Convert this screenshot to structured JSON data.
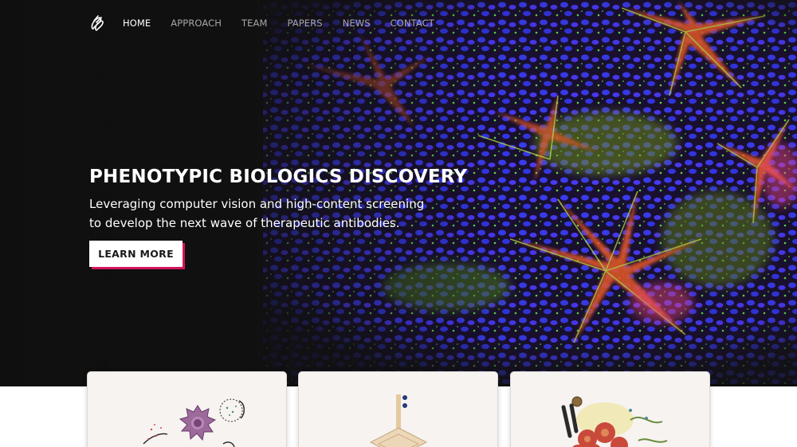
{
  "nav": {
    "logo_icon": "rootpath-logo-icon",
    "items": [
      {
        "label": "HOME",
        "active": true
      },
      {
        "label": "APPROACH",
        "active": false
      },
      {
        "label": "TEAM",
        "active": false
      },
      {
        "label": "PAPERS",
        "active": false
      },
      {
        "label": "NEWS",
        "active": false
      },
      {
        "label": "CONTACT",
        "active": false
      }
    ]
  },
  "hero": {
    "title": "PHENOTYPIC BIOLOGICS DISCOVERY",
    "subtitle": "Leveraging computer vision and high-content screening to develop the next wave of therapeutic antibodies.",
    "cta_label": "LEARN MORE",
    "background_image": "fluorescence-microscopy-cells",
    "accent_color": "#d4145a"
  },
  "cards": [
    {
      "illustration": "immune-cell-illustration"
    },
    {
      "illustration": "screening-plate-illustration"
    },
    {
      "illustration": "tissue-antibody-illustration"
    }
  ]
}
